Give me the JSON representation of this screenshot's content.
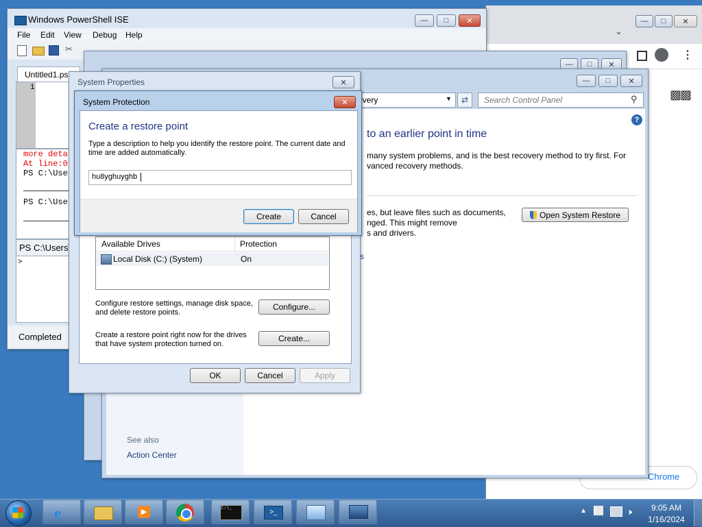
{
  "colors": {
    "taskbar": "#2f5b8f",
    "dialog_heading": "#1e3287",
    "link": "#1e4e8c",
    "console_red": "#e60000"
  },
  "ise": {
    "title": "Windows PowerShell ISE",
    "menu": [
      "File",
      "Edit",
      "View",
      "Debug",
      "Help"
    ],
    "tab": "Untitled1.ps",
    "line_number": "1",
    "console_lines": [
      "more deta",
      "At line:0",
      "PS C:\\Use",
      "PS C:\\Use"
    ],
    "prompt": "PS C:\\Users\\",
    "input": ">",
    "status": "Completed"
  },
  "control_panel": {
    "address": "overy",
    "search_placeholder": "Search Control Panel",
    "heading": "to an earlier point in time",
    "desc1": "many system problems, and is the best recovery method to try first. For",
    "desc2": "vanced recovery methods.",
    "restore_text1": "es, but leave files such as documents,",
    "restore_text2": "nged. This might remove",
    "restore_text3": "s and drivers.",
    "open_restore_button": "Open System Restore",
    "fragment": "s",
    "see_also": "See also",
    "action_center": "Action Center"
  },
  "chrome": {
    "fragment": "Chrome"
  },
  "system_properties": {
    "title": "System Properties",
    "col_drives": "Available Drives",
    "col_protection": "Protection",
    "drive_name": "Local Disk (C:) (System)",
    "drive_protection": "On",
    "configure_text": "Configure restore settings, manage disk space, and delete restore points.",
    "configure_button": "Configure...",
    "create_text": "Create a restore point right now for the drives that have system protection turned on.",
    "create_button": "Create...",
    "ok": "OK",
    "cancel": "Cancel",
    "apply": "Apply"
  },
  "system_protection": {
    "title": "System Protection",
    "heading": "Create a restore point",
    "description": "Type a description to help you identify the restore point. The current date and time are added automatically.",
    "input_value": "hu8yghuyghb",
    "create": "Create",
    "cancel": "Cancel"
  },
  "taskbar": {
    "time": "9:05 AM",
    "date": "1/16/2024"
  }
}
